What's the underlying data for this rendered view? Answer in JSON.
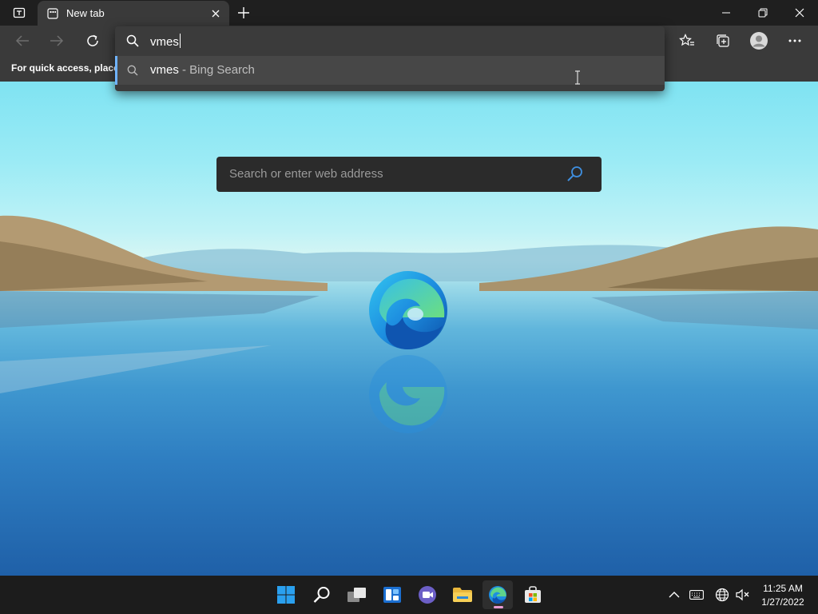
{
  "browser": {
    "tab": {
      "title": "New tab"
    },
    "favorites_bar": {
      "message": "For quick access, place y"
    },
    "omnibox": {
      "value": "vmes",
      "suggestions": [
        {
          "query": "vmes",
          "source": " - Bing Search"
        }
      ]
    }
  },
  "new_tab_page": {
    "search": {
      "placeholder": "Search or enter web address"
    }
  },
  "taskbar": {
    "apps": [
      "start-icon",
      "search-icon",
      "task-view-icon",
      "widgets-icon",
      "teams-chat-icon",
      "file-explorer-icon",
      "edge-icon",
      "store-icon"
    ],
    "clock": {
      "time": "11:25 AM",
      "date": "1/27/2022"
    }
  },
  "colors": {
    "accent": "#6fb3ff",
    "toolbar": "#3a3a3a",
    "titlebar": "#1f1f1f",
    "taskbar": "#1c1c1c",
    "active_indicator": "#e89ad2"
  }
}
